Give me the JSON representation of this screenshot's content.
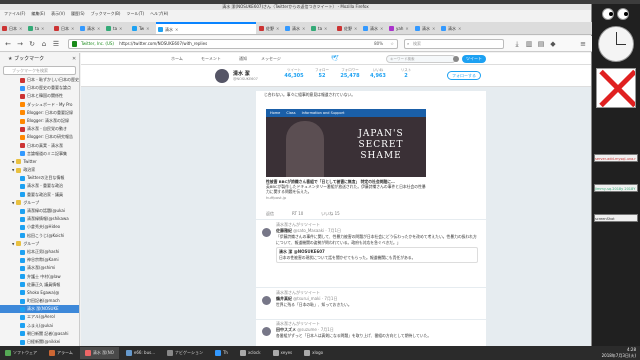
{
  "window": {
    "title": "清水 潔(NOSUKE607)さん（Twitterからの返信つきツイート） - Mozilla Firefox"
  },
  "menu": [
    "ファイル(F)",
    "編集(E)",
    "表示(V)",
    "履歴(S)",
    "ブックマーク(B)",
    "ツール(T)",
    "ヘルプ(H)"
  ],
  "tabs": [
    {
      "label": "日本",
      "color": "#c33"
    },
    {
      "label": "ta",
      "color": "#3a7"
    },
    {
      "label": "日本",
      "color": "#c33"
    },
    {
      "label": "清水",
      "color": "#39f"
    },
    {
      "label": "ta",
      "color": "#3a7"
    },
    {
      "label": "Tw",
      "color": "#1da1f2"
    },
    {
      "label": "清水",
      "color": "#1da1f2",
      "active": true
    },
    {
      "label": "佐野",
      "color": "#c33"
    },
    {
      "label": "清水",
      "color": "#39f"
    },
    {
      "label": "ta",
      "color": "#3a7"
    },
    {
      "label": "佐野",
      "color": "#c33"
    },
    {
      "label": "清水",
      "color": "#39f"
    },
    {
      "label": "yah",
      "color": "#a3c"
    },
    {
      "label": "清水",
      "color": "#39f"
    },
    {
      "label": "清水",
      "color": "#39f"
    }
  ],
  "nav": {
    "url": "https://twitter.com/NOSUKE607/with_replies",
    "site_badge": "Twitter, Inc. (US)",
    "zoom": "80%",
    "search_placeholder": "検索"
  },
  "sidebar": {
    "title": "ブックマーク",
    "search_placeholder": "ブックマークを検索",
    "items": [
      {
        "label": "日本 - 恥ずかしい日本の歴史",
        "color": "#c33",
        "indent": 1
      },
      {
        "label": "日本の歴史の重要な論点",
        "color": "#39f",
        "indent": 1
      },
      {
        "label": "日本と韓国の関係性",
        "color": "#c33",
        "indent": 1
      },
      {
        "label": "ダッシュボード - My Pro",
        "color": "#f80",
        "indent": 1
      },
      {
        "label": "Blogger: 日本の重要記録",
        "color": "#f80",
        "indent": 1
      },
      {
        "label": "Blogger: 清水潔の記録",
        "color": "#f80",
        "indent": 1
      },
      {
        "label": "清水潔 - 自民党の動き",
        "color": "#c33",
        "indent": 1
      },
      {
        "label": "Blogger: 日本の研究報告",
        "color": "#f80",
        "indent": 1
      },
      {
        "label": "日本の真実 - 清水潔",
        "color": "#c33",
        "indent": 1
      },
      {
        "label": "言論報道のミニ記事集",
        "color": "#39f",
        "indent": 1
      },
      {
        "label": "Twitter",
        "color": "#e8c040",
        "indent": 0,
        "folder": true
      },
      {
        "label": "政治家",
        "color": "#e8c040",
        "indent": 0,
        "folder": true
      },
      {
        "label": "Twitterの注目な情報",
        "color": "#1da1f2",
        "indent": 1
      },
      {
        "label": "清水潔 - 重要な政治",
        "color": "#1da1f2",
        "indent": 1
      },
      {
        "label": "重要な政治家 - 議員",
        "color": "#1da1f2",
        "indent": 1
      },
      {
        "label": "グループ",
        "color": "#e8c040",
        "indent": 0,
        "folder": true
      },
      {
        "label": "清潔緑の話題(@ukai",
        "color": "#1da1f2",
        "indent": 1
      },
      {
        "label": "清潔緑情報(@shikawa",
        "color": "#1da1f2",
        "indent": 1
      },
      {
        "label": "小倉秀夫(@Hideo",
        "color": "#1da1f2",
        "indent": 1
      },
      {
        "label": "松田こうじ(@Koichi",
        "color": "#1da1f2",
        "indent": 1
      },
      {
        "label": "グループ",
        "color": "#e8c040",
        "indent": 0,
        "folder": true
      },
      {
        "label": "松本正男(@hashi",
        "color": "#1da1f2",
        "indent": 1
      },
      {
        "label": "神谷宗幣(@Kami",
        "color": "#1da1f2",
        "indent": 1
      },
      {
        "label": "清水潔(@shimi",
        "color": "#1da1f2",
        "indent": 1
      },
      {
        "label": "弁護士 中村(@law",
        "color": "#1da1f2",
        "indent": 1
      },
      {
        "label": "佐藤正久 議員情報",
        "color": "#1da1f2",
        "indent": 1
      },
      {
        "label": "Shoko Egawa(@",
        "color": "#1da1f2",
        "indent": 1
      },
      {
        "label": "町田記者(@mach",
        "color": "#1da1f2",
        "indent": 1
      },
      {
        "label": "清水 潔(NOSUKE",
        "color": "#1da1f2",
        "indent": 1,
        "selected": true
      },
      {
        "label": "エアル(@Aerol",
        "color": "#1da1f2",
        "indent": 1
      },
      {
        "label": "ふまえ(@ukai",
        "color": "#1da1f2",
        "indent": 1
      },
      {
        "label": "朝日新聞 記者(@asahi",
        "color": "#1da1f2",
        "indent": 1
      },
      {
        "label": "日経新聞(@nikkei",
        "color": "#1da1f2",
        "indent": 1
      }
    ]
  },
  "twitter": {
    "nav": [
      "ホーム",
      "モーメント",
      "通知",
      "メッセージ"
    ],
    "search_placeholder": "キーワード検索",
    "tweet_button": "ツイート",
    "profile": {
      "name": "清水 潔",
      "handle": "@NOSUKE607"
    },
    "stats": [
      {
        "label": "ツイート",
        "value": "46,305"
      },
      {
        "label": "フォロー",
        "value": "52"
      },
      {
        "label": "フォロワー",
        "value": "25,478"
      },
      {
        "label": "いいね",
        "value": "4,963"
      },
      {
        "label": "リスト",
        "value": "2"
      }
    ],
    "follow_button": "フォローする",
    "first_text": "じ合わない。事々に組事的意見は報道されていない。",
    "card": {
      "nav": [
        "Home",
        "Class",
        "Information and Support"
      ],
      "caption": "JAPAN'S SECRET SHAME",
      "title": "性被害 BBCが詩織さん番組で「日として被害に無言」 特定の社会問題に…",
      "body": "英BBCが製作したドキュメンタリー番組が放送された。伊藤詩織さんの事件と日本社会の性暴力に関する問題を伝えた。",
      "site": "huffpost.jp"
    },
    "actions": [
      "返信",
      "RT 10",
      "いいね 15"
    ],
    "tweets": [
      {
        "retweet_note": "清水潔さんがリツイート",
        "name": "佐藤雅紀",
        "handle": "@sato_Masaaki · 7月1日",
        "text": "「伊藤詩織さんの事件に関して、性暴力被害の問題が日本社会にどう伝わったかを改めて考えたい。性暴力の扱われ方について、報道機関の姿勢が問われている。政府も対応を急ぐべきだ。」",
        "quote_name": "清水 潔 @NOSUKE607",
        "quote": "日本の性被害の現状について話を聞かせてもらった。報道機関にも責任がある。"
      },
      {
        "retweet_note": "清水潔さんがリツイート",
        "name": "鶴井真紀",
        "handle": "@tsurui_maki · 7月1日",
        "text": "世界に残る「日本の恥」、知っておきたい。"
      },
      {
        "retweet_note": "清水潔さんがリツイート",
        "name": "田中スズメ",
        "handle": "@suzume · 7月1日",
        "text": "各番組がずっと「日本人は真剣になる問題」を取り上げ、番組の方向として期待していた。"
      }
    ]
  },
  "right_panel": {
    "items": [
      "server-add-mysql-una.r",
      "Jimmy-sq.2018y 2018Y",
      "screenShot"
    ]
  },
  "taskbar": {
    "items": [
      "ソフトウェア",
      "アラーム",
      "清水 潔(NO",
      "e66: bus...",
      "ナビゲーション",
      "Th",
      "xclock",
      "xeyes",
      "xlogo"
    ],
    "time": "4:28",
    "date": "2018年7月3日(火)"
  }
}
